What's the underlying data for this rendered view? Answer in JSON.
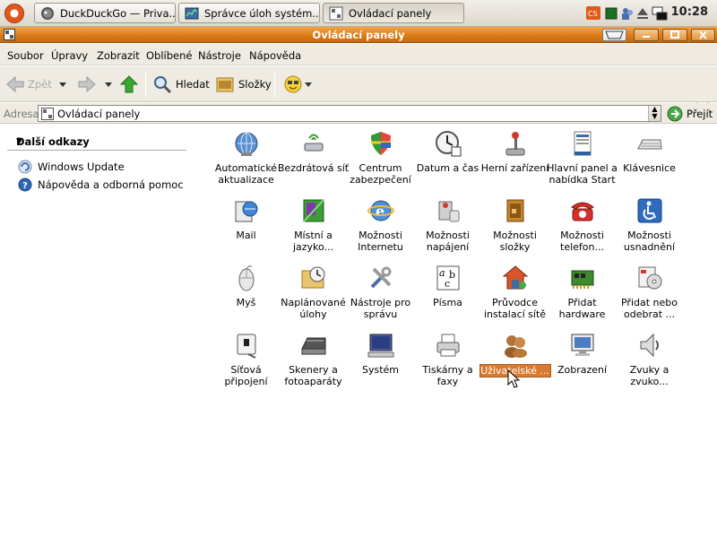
{
  "taskbar": {
    "tasks": [
      {
        "label": "DuckDuckGo — Priva..."
      },
      {
        "label": "Správce úloh systém..."
      },
      {
        "label": "Ovládací panely"
      }
    ],
    "clock": "10:28"
  },
  "window": {
    "title": "Ovládací panely"
  },
  "menu": {
    "items": [
      "Soubor",
      "Úpravy",
      "Zobrazit",
      "Oblíbené",
      "Nástroje",
      "Nápověda"
    ]
  },
  "toolbar": {
    "back": "Zpět",
    "search": "Hledat",
    "folders": "Složky"
  },
  "address": {
    "label": "Adresa",
    "value": "Ovládací panely",
    "go": "Přejít"
  },
  "sidebar": {
    "header": "Další odkazy",
    "links": [
      "Windows Update",
      "Nápověda a odborná pomoc"
    ]
  },
  "icons": [
    {
      "label": "Automatické aktualizace",
      "icon": "globe-update-icon"
    },
    {
      "label": "Bezdrátová síť",
      "icon": "wireless-icon"
    },
    {
      "label": "Centrum zabezpečení",
      "icon": "shield-icon"
    },
    {
      "label": "Datum a čas",
      "icon": "clock-icon"
    },
    {
      "label": "Herní zařízení",
      "icon": "joystick-icon"
    },
    {
      "label": "Hlavní panel a nabídka Start",
      "icon": "taskbar-icon"
    },
    {
      "label": "Klávesnice",
      "icon": "keyboard-icon"
    },
    {
      "label": "Mail",
      "icon": "mail-icon"
    },
    {
      "label": "Místní a jazyko...",
      "icon": "globe-language-icon"
    },
    {
      "label": "Možnosti Internetu",
      "icon": "internet-icon"
    },
    {
      "label": "Možnosti napájení",
      "icon": "power-icon"
    },
    {
      "label": "Možnosti složky",
      "icon": "folder-options-icon"
    },
    {
      "label": "Možnosti telefon...",
      "icon": "phone-icon"
    },
    {
      "label": "Možnosti usnadnění",
      "icon": "accessibility-icon"
    },
    {
      "label": "Myš",
      "icon": "mouse-icon"
    },
    {
      "label": "Naplánované úlohy",
      "icon": "scheduled-tasks-icon"
    },
    {
      "label": "Nástroje pro správu",
      "icon": "tools-icon"
    },
    {
      "label": "Písma",
      "icon": "fonts-icon"
    },
    {
      "label": "Průvodce instalací sítě",
      "icon": "network-wizard-icon"
    },
    {
      "label": "Přidat hardware",
      "icon": "hardware-icon"
    },
    {
      "label": "Přidat nebo odebrat ...",
      "icon": "add-remove-icon"
    },
    {
      "label": "Síťová připojení",
      "icon": "network-icon"
    },
    {
      "label": "Skenery a fotoaparáty",
      "icon": "scanner-icon"
    },
    {
      "label": "Systém",
      "icon": "system-icon"
    },
    {
      "label": "Tiskárny a faxy",
      "icon": "printer-icon"
    },
    {
      "label": "Uživatelské ...",
      "icon": "users-icon",
      "selected": true
    },
    {
      "label": "Zobrazení",
      "icon": "display-icon"
    },
    {
      "label": "Zvuky a zvuko...",
      "icon": "sound-icon"
    }
  ],
  "colors": {
    "titlebar": "#d97a17",
    "selection": "#d87a2f",
    "menu_bg": "#efebe3"
  }
}
